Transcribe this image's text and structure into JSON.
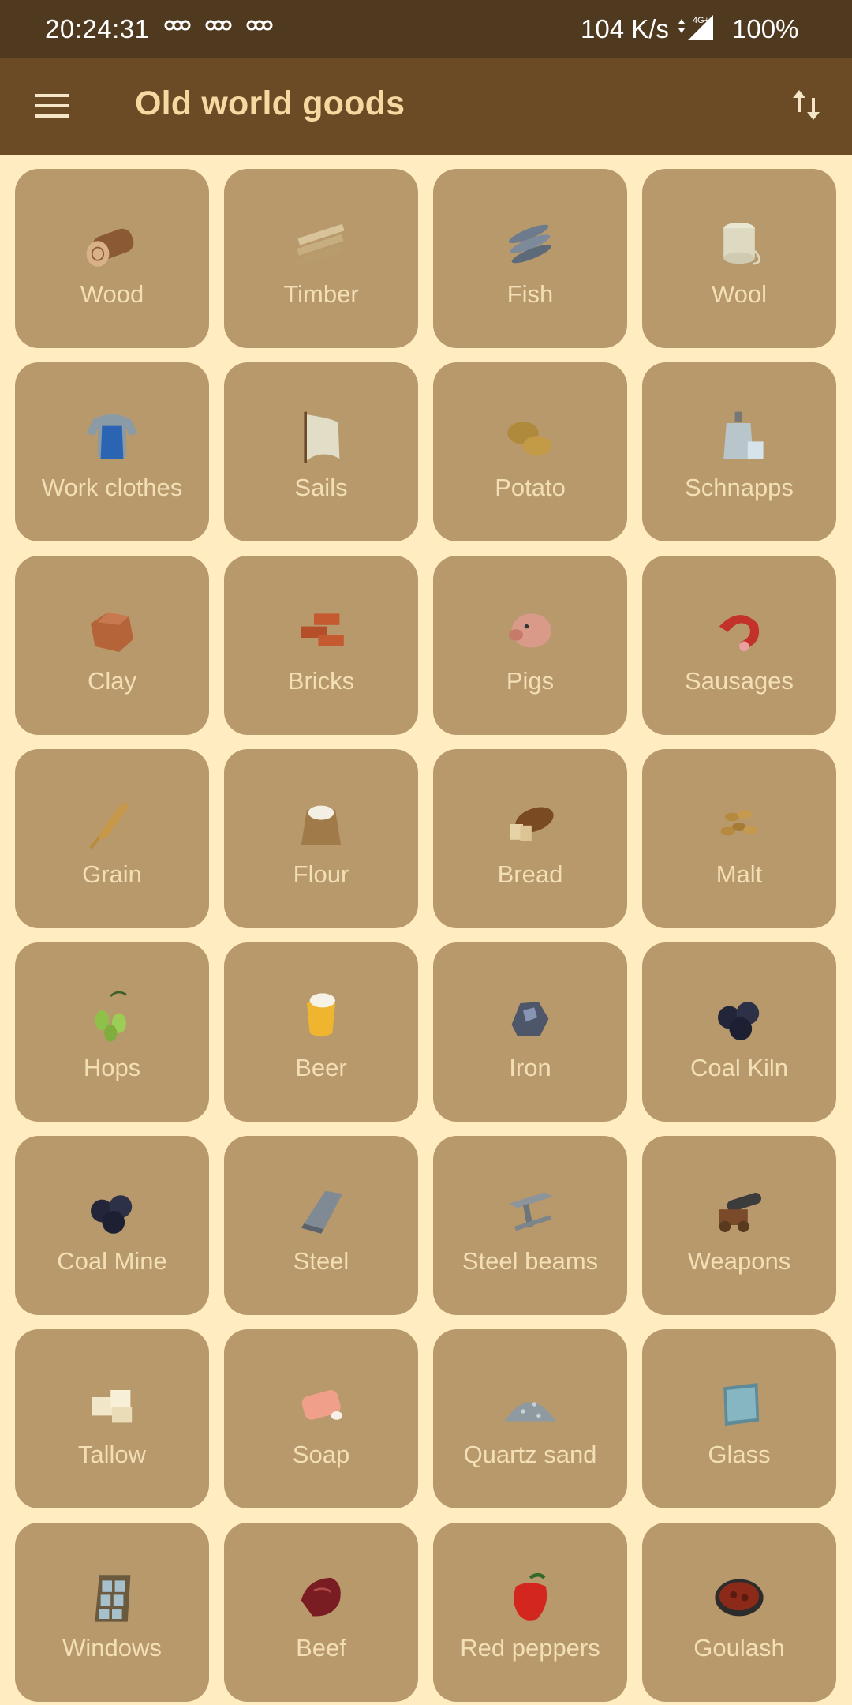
{
  "status_bar": {
    "time": "20:24:31",
    "network_speed": "104 K/s",
    "network_type": "4G+",
    "battery": "100%"
  },
  "app_bar": {
    "title": "Old world goods",
    "menu_icon": "hamburger-menu-icon",
    "sort_icon": "sort-arrows-icon"
  },
  "colors": {
    "status_bar_bg": "#4f3a1f",
    "app_bar_bg": "#6a4b26",
    "page_bg": "#ffecc1",
    "tile_bg": "#b8996b",
    "tile_text": "#f3dfb6",
    "title_text": "#f5d9a0"
  },
  "goods": [
    {
      "label": "Wood",
      "icon": "wood-log-icon"
    },
    {
      "label": "Timber",
      "icon": "timber-planks-icon"
    },
    {
      "label": "Fish",
      "icon": "fish-icon"
    },
    {
      "label": "Wool",
      "icon": "wool-spool-icon"
    },
    {
      "label": "Work clothes",
      "icon": "work-clothes-icon"
    },
    {
      "label": "Sails",
      "icon": "sails-icon"
    },
    {
      "label": "Potato",
      "icon": "potato-icon"
    },
    {
      "label": "Schnapps",
      "icon": "schnapps-bottle-icon"
    },
    {
      "label": "Clay",
      "icon": "clay-icon"
    },
    {
      "label": "Bricks",
      "icon": "bricks-icon"
    },
    {
      "label": "Pigs",
      "icon": "pig-icon"
    },
    {
      "label": "Sausages",
      "icon": "sausage-icon"
    },
    {
      "label": "Grain",
      "icon": "grain-icon"
    },
    {
      "label": "Flour",
      "icon": "flour-sack-icon"
    },
    {
      "label": "Bread",
      "icon": "bread-icon"
    },
    {
      "label": "Malt",
      "icon": "malt-icon"
    },
    {
      "label": "Hops",
      "icon": "hops-icon"
    },
    {
      "label": "Beer",
      "icon": "beer-glass-icon"
    },
    {
      "label": "Iron",
      "icon": "iron-ore-icon"
    },
    {
      "label": "Coal Kiln",
      "icon": "coal-kiln-icon"
    },
    {
      "label": "Coal Mine",
      "icon": "coal-mine-icon"
    },
    {
      "label": "Steel",
      "icon": "steel-ingot-icon"
    },
    {
      "label": "Steel beams",
      "icon": "steel-beam-icon"
    },
    {
      "label": "Weapons",
      "icon": "cannon-icon"
    },
    {
      "label": "Tallow",
      "icon": "tallow-icon"
    },
    {
      "label": "Soap",
      "icon": "soap-icon"
    },
    {
      "label": "Quartz sand",
      "icon": "quartz-sand-icon"
    },
    {
      "label": "Glass",
      "icon": "glass-pane-icon"
    },
    {
      "label": "Windows",
      "icon": "window-icon"
    },
    {
      "label": "Beef",
      "icon": "beef-icon"
    },
    {
      "label": "Red peppers",
      "icon": "red-pepper-icon"
    },
    {
      "label": "Goulash",
      "icon": "goulash-pot-icon"
    }
  ]
}
